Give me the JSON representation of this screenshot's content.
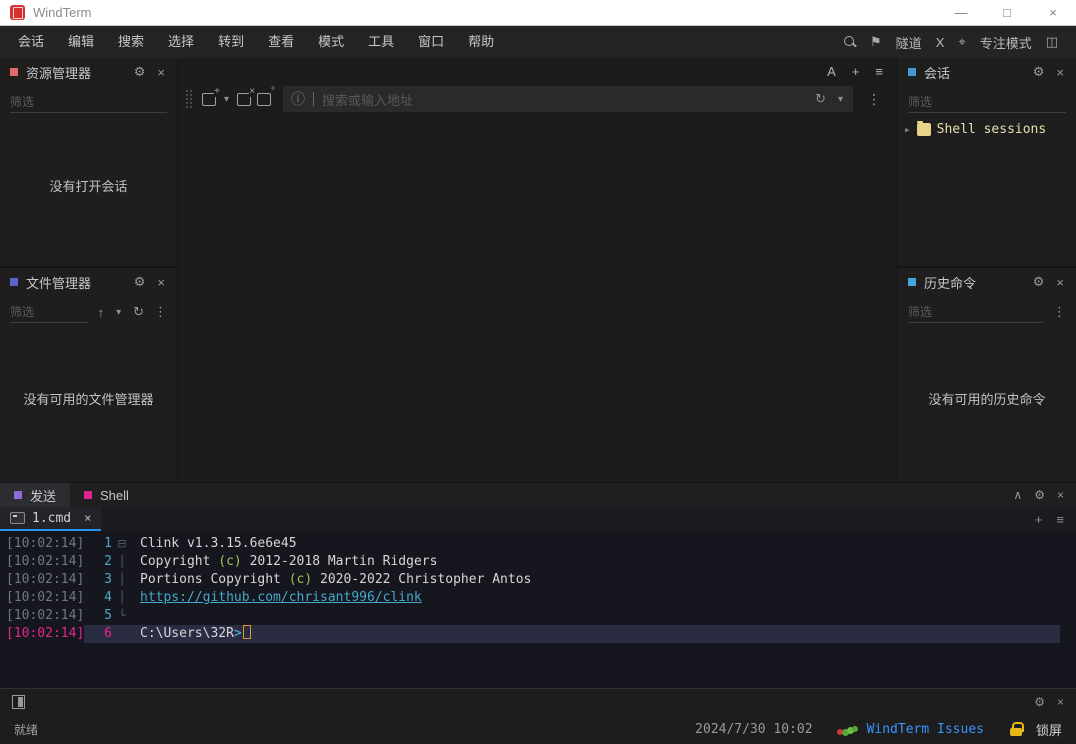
{
  "window": {
    "title": "WindTerm",
    "controls": {
      "minimize": "—",
      "maximize": "□",
      "close": "×"
    }
  },
  "menu": {
    "items": [
      "会话",
      "编辑",
      "搜索",
      "选择",
      "转到",
      "查看",
      "模式",
      "工具",
      "窗口",
      "帮助"
    ],
    "right": {
      "tunnel_label": "隧道",
      "x_label": "X",
      "focus_label": "专注模式"
    }
  },
  "toolbar": {
    "a_label": "A",
    "add_label": "+",
    "menu_label": "≡"
  },
  "address_bar": {
    "placeholder": "搜索或输入地址"
  },
  "panels": {
    "explorer": {
      "title": "资源管理器",
      "filter_placeholder": "筛选",
      "empty": "没有打开会话",
      "accent": "#e06a6a"
    },
    "file_manager": {
      "title": "文件管理器",
      "filter_placeholder": "筛选",
      "empty": "没有可用的文件管理器",
      "accent": "#5b63c9"
    },
    "session": {
      "title": "会话",
      "filter_placeholder": "筛选",
      "tree_item": "Shell sessions",
      "accent": "#3f9bd8"
    },
    "history": {
      "title": "历史命令",
      "filter_placeholder": "筛选",
      "empty": "没有可用的历史命令",
      "accent": "#4aa3e0"
    }
  },
  "bottom": {
    "tabs": [
      {
        "label": "发送",
        "accent": "#8d6bd8",
        "active": true
      },
      {
        "label": "Shell",
        "accent": "#e0218a",
        "active": false
      }
    ],
    "file_tab": {
      "label": "1.cmd"
    },
    "terminal": {
      "lines": [
        {
          "time": "[10:02:14]",
          "num": "1",
          "fold": "minus",
          "hl": false,
          "segments": [
            {
              "c": "d",
              "text": "Clink v1.3.15.6e6e45"
            }
          ]
        },
        {
          "time": "[10:02:14]",
          "num": "2",
          "fold": "line",
          "hl": false,
          "segments": [
            {
              "c": "d",
              "text": "Copyright "
            },
            {
              "c": "g",
              "text": "(c)"
            },
            {
              "c": "d",
              "text": " 2012-2018 Martin Ridgers"
            }
          ]
        },
        {
          "time": "[10:02:14]",
          "num": "3",
          "fold": "line",
          "hl": false,
          "segments": [
            {
              "c": "d",
              "text": "Portions Copyright "
            },
            {
              "c": "g",
              "text": "(c)"
            },
            {
              "c": "d",
              "text": " 2020-2022 Christopher Antos"
            }
          ]
        },
        {
          "time": "[10:02:14]",
          "num": "4",
          "fold": "line",
          "hl": false,
          "segments": [
            {
              "c": "l",
              "text": "https://github.com/chrisant996/clink"
            }
          ]
        },
        {
          "time": "[10:02:14]",
          "num": "5",
          "fold": "end",
          "hl": false,
          "segments": []
        },
        {
          "time": "[10:02:14]",
          "num": "6",
          "fold": "",
          "hl": true,
          "cursor": true,
          "segments": [
            {
              "c": "d",
              "text": "C:\\Users\\32R"
            },
            {
              "c": "c",
              "text": ">"
            }
          ]
        }
      ],
      "colors": {
        "timestamp": "#717785",
        "line_number": "#4fa8c2",
        "highlight_row": "#2a2d42",
        "highlight_accent": "#e6268c",
        "copyright_c": "#97c554",
        "link": "#45a9c9",
        "prompt_arrow": "#49b8d6",
        "cursor": "#d79a28"
      }
    }
  },
  "status_bar": {
    "ready": "就绪",
    "datetime": "2024/7/30 10:02",
    "issues_link": "WindTerm Issues",
    "lock_label": "锁屏",
    "link_color": "#3794ff"
  }
}
